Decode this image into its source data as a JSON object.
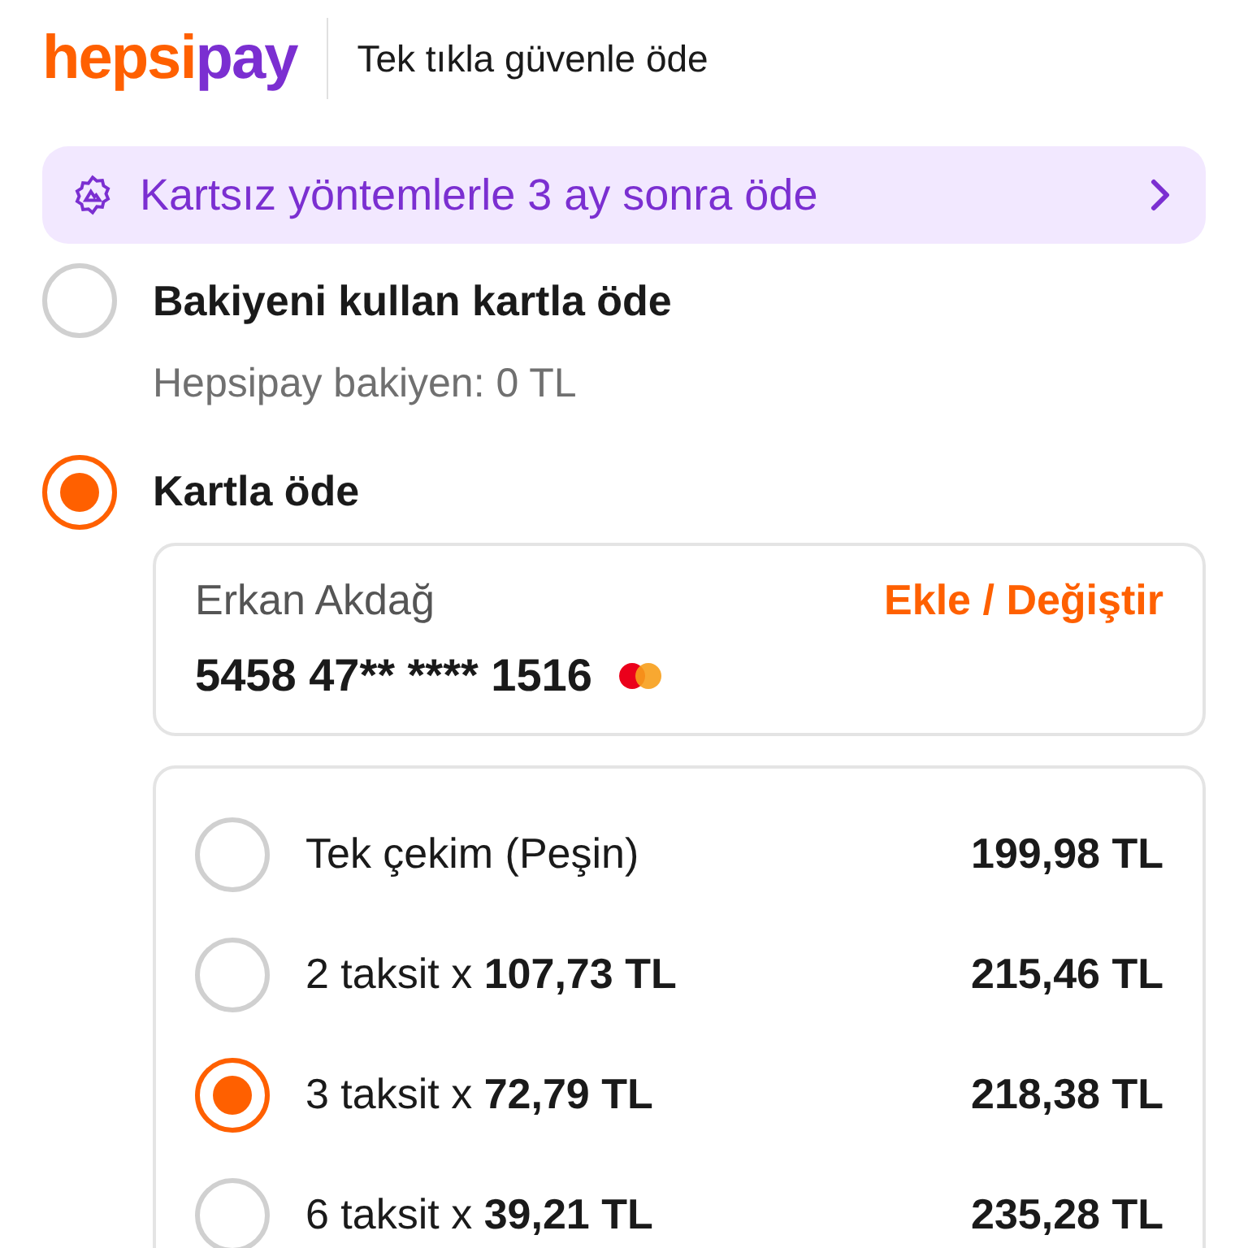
{
  "header": {
    "logo": {
      "part_1": "hepsi",
      "part_2": "pay"
    },
    "tagline": "Tek tıkla güvenle öde"
  },
  "promo_banner": {
    "text": "Kartsız yöntemlerle 3 ay sonra öde"
  },
  "payment_options": [
    {
      "kind": "balance",
      "label": "Bakiyeni kullan kartla öde",
      "sublabel": "Hepsipay bakiyen: 0 TL",
      "selected": false
    },
    {
      "kind": "card",
      "label": "Kartla öde",
      "selected": true
    }
  ],
  "card": {
    "holder": "Erkan Akdağ",
    "number": "5458 47** **** 1516",
    "change_link": "Ekle / Değiştir"
  },
  "installments": [
    {
      "label": "Tek çekim (Peşin)",
      "total": "199,98 TL",
      "selected": false
    },
    {
      "label": "2 taksit x **107,73 TL**",
      "total": "215,46 TL",
      "selected": false
    },
    {
      "label": "3 taksit x **72,79 TL**",
      "total": "218,38 TL",
      "selected": true
    },
    {
      "label": "6 taksit x **39,21 TL**",
      "total": "235,28 TL",
      "selected": false
    }
  ]
}
